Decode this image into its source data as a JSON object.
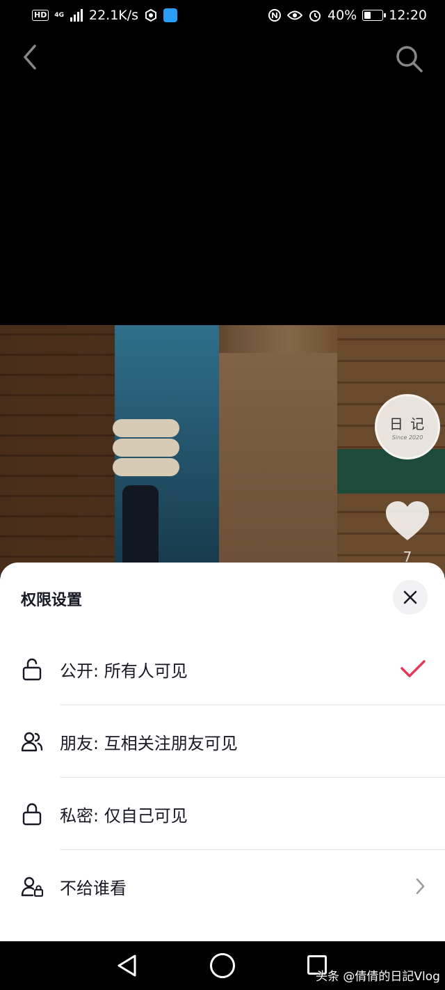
{
  "status_bar": {
    "hd": "HD",
    "network": "4G",
    "speed": "22.1K/s",
    "battery": "40%",
    "battery_level": 0.4,
    "time": "12:20"
  },
  "nav": {
    "back_icon": "chevron-left-icon",
    "search_icon": "search-icon"
  },
  "video": {
    "avatar_title": "日 记",
    "avatar_sub": "Since 2020",
    "like_count": "7"
  },
  "sheet": {
    "title": "权限设置",
    "options": [
      {
        "label": "公开: 所有人可见",
        "icon": "unlock-icon",
        "selected": true
      },
      {
        "label": "朋友: 互相关注朋友可见",
        "icon": "friends-icon",
        "selected": false
      },
      {
        "label": "私密: 仅自己可见",
        "icon": "lock-icon",
        "selected": false
      },
      {
        "label": "不给谁看",
        "icon": "user-lock-icon",
        "selected": false,
        "has_chevron": true
      }
    ],
    "accent_color": "#e8385a"
  },
  "watermark": "头条 @倩倩的日記Vlog"
}
